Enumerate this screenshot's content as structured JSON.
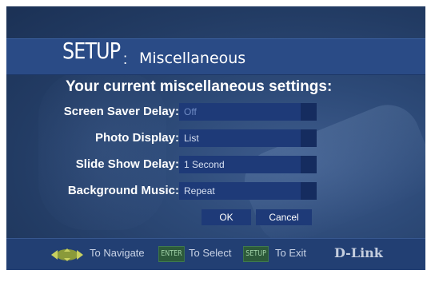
{
  "title": {
    "main": "SETUP",
    "separator": ":",
    "section": "Miscellaneous"
  },
  "heading": "Your current miscellaneous settings:",
  "settings": [
    {
      "label": "Screen Saver Delay:",
      "value": "Off"
    },
    {
      "label": "Photo Display:",
      "value": "List"
    },
    {
      "label": "Slide Show Delay:",
      "value": "1 Second"
    },
    {
      "label": "Background Music:",
      "value": "Repeat"
    }
  ],
  "buttons": {
    "ok": "OK",
    "cancel": "Cancel"
  },
  "footer": {
    "navigate": "To Navigate",
    "enter_key": "ENTER",
    "select": "To Select",
    "setup_key": "SETUP",
    "exit": "To Exit",
    "brand": "D-Link"
  },
  "icons": {
    "navigate": "directional-pad-icon"
  },
  "colors": {
    "background": "#2d4a78",
    "title_bar": "#2a4b86",
    "field": "#1e3a78",
    "key": "#2d5a3a"
  }
}
